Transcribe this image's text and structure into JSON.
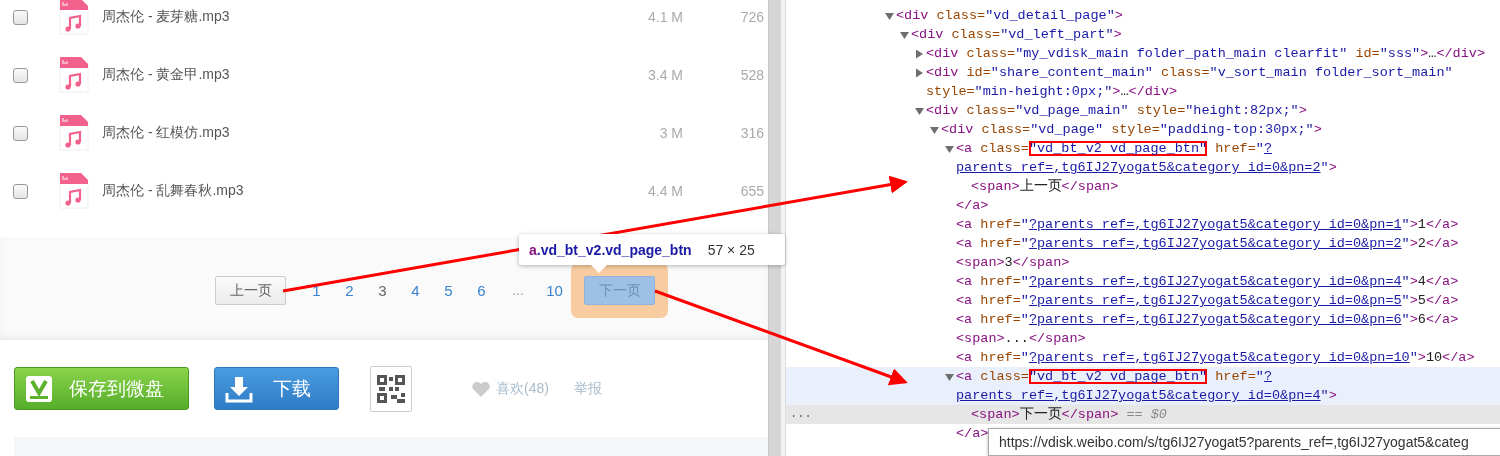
{
  "file_list": [
    {
      "name": "周杰伦 - 麦芽糖.mp3",
      "size": "4.1 M",
      "count": "726",
      "checked": false
    },
    {
      "name": "周杰伦 - 黄金甲.mp3",
      "size": "3.4 M",
      "count": "528",
      "checked": false
    },
    {
      "name": "周杰伦 - 红模仿.mp3",
      "size": "3 M",
      "count": "316",
      "checked": false
    },
    {
      "name": "周杰伦 - 乱舞春秋.mp3",
      "size": "4.4 M",
      "count": "655",
      "checked": false
    }
  ],
  "pagination": {
    "prev": {
      "label": "上一页",
      "inspected": false
    },
    "pages": [
      {
        "kind": "page",
        "label": "1",
        "selected": false
      },
      {
        "kind": "page",
        "label": "2",
        "selected": false
      },
      {
        "kind": "page",
        "label": "3",
        "selected": true
      },
      {
        "kind": "page",
        "label": "4",
        "selected": false
      },
      {
        "kind": "page",
        "label": "5",
        "selected": false
      },
      {
        "kind": "page",
        "label": "6",
        "selected": false
      },
      {
        "kind": "gap",
        "label": "...",
        "selected": false
      },
      {
        "kind": "page",
        "label": "10",
        "selected": false
      }
    ],
    "next": {
      "label": "下一页",
      "inspected": true
    }
  },
  "inspect_tooltip": {
    "tag": "a",
    "classes": ".vd_bt_v2.vd_page_btn",
    "size": "57 × 25"
  },
  "actions": {
    "save": "保存到微盘",
    "download": "下载",
    "like": "喜欢(48)",
    "report": "举报"
  },
  "dom_tree": [
    {
      "kind": "branch",
      "expanded": true,
      "selected": false,
      "open": [
        {
          "kind": "tag",
          "text": "<div"
        },
        {
          "kind": "attr",
          "text": " class="
        },
        {
          "kind": "val",
          "text": "\"vd_detail_page\""
        },
        {
          "kind": "tag",
          "text": ">"
        }
      ],
      "children": [
        {
          "kind": "branch",
          "expanded": true,
          "selected": false,
          "open": [
            {
              "kind": "tag",
              "text": "<div"
            },
            {
              "kind": "attr",
              "text": " class="
            },
            {
              "kind": "val",
              "text": "\"vd_left_part\""
            },
            {
              "kind": "tag",
              "text": ">"
            }
          ],
          "children": [
            {
              "kind": "branch",
              "expanded": false,
              "selected": false,
              "open": [
                {
                  "kind": "tag",
                  "text": "<div"
                },
                {
                  "kind": "attr",
                  "text": " class="
                },
                {
                  "kind": "val",
                  "text": "\"my_vdisk_main folder_path_main clearfit\""
                },
                {
                  "kind": "attr",
                  "text": " id="
                },
                {
                  "kind": "val",
                  "text": "\"sss\""
                },
                {
                  "kind": "tag",
                  "text": ">"
                },
                {
                  "kind": "text",
                  "text": "…"
                },
                {
                  "kind": "tag",
                  "text": "</div>"
                }
              ]
            },
            {
              "kind": "branch",
              "expanded": false,
              "selected": false,
              "open": [
                {
                  "kind": "tag",
                  "text": "<div"
                },
                {
                  "kind": "attr",
                  "text": " id="
                },
                {
                  "kind": "val",
                  "text": "\"share_content_main\""
                },
                {
                  "kind": "attr",
                  "text": " class="
                },
                {
                  "kind": "val",
                  "text": "\"v_sort_main folder_sort_main\""
                },
                {
                  "kind": "attr",
                  "text": " style="
                },
                {
                  "kind": "val",
                  "text": "\"min-height:0px;\""
                },
                {
                  "kind": "tag",
                  "text": ">"
                },
                {
                  "kind": "text",
                  "text": "…"
                },
                {
                  "kind": "tag",
                  "text": "</div>"
                }
              ]
            },
            {
              "kind": "branch",
              "expanded": true,
              "selected": false,
              "open": [
                {
                  "kind": "tag",
                  "text": "<div"
                },
                {
                  "kind": "attr",
                  "text": " class="
                },
                {
                  "kind": "val",
                  "text": "\"vd_page_main\""
                },
                {
                  "kind": "attr",
                  "text": " style="
                },
                {
                  "kind": "val",
                  "text": "\"height:82px;\""
                },
                {
                  "kind": "tag",
                  "text": ">"
                }
              ],
              "children": [
                {
                  "kind": "branch",
                  "expanded": true,
                  "selected": false,
                  "open": [
                    {
                      "kind": "tag",
                      "text": "<div"
                    },
                    {
                      "kind": "attr",
                      "text": " class="
                    },
                    {
                      "kind": "val",
                      "text": "\"vd_page\""
                    },
                    {
                      "kind": "attr",
                      "text": " style="
                    },
                    {
                      "kind": "val",
                      "text": "\"padding-top:30px;\""
                    },
                    {
                      "kind": "tag",
                      "text": ">"
                    }
                  ],
                  "children": [
                    {
                      "kind": "branch",
                      "expanded": true,
                      "selected": false,
                      "open": [
                        {
                          "kind": "tag",
                          "text": "<a"
                        },
                        {
                          "kind": "attr",
                          "text": " class="
                        },
                        {
                          "kind": "valbox",
                          "text": "\"vd_bt_v2 vd_page_btn\""
                        },
                        {
                          "kind": "attr",
                          "text": " href="
                        },
                        {
                          "kind": "val",
                          "text": "\""
                        },
                        {
                          "kind": "link",
                          "text": "?parents_ref=,tg6IJ27yogat5&category_id=0&pn=2"
                        },
                        {
                          "kind": "val",
                          "text": "\""
                        },
                        {
                          "kind": "tag",
                          "text": ">"
                        }
                      ],
                      "children": [
                        {
                          "kind": "leaf",
                          "selected": false,
                          "open": [
                            {
                              "kind": "tag",
                              "text": "<span>"
                            },
                            {
                              "kind": "text",
                              "text": "上一页"
                            },
                            {
                              "kind": "tag",
                              "text": "</span>"
                            }
                          ]
                        }
                      ],
                      "close": [
                        {
                          "kind": "tag",
                          "text": "</a>"
                        }
                      ]
                    },
                    {
                      "kind": "leaf",
                      "selected": false,
                      "open": [
                        {
                          "kind": "tag",
                          "text": "<a"
                        },
                        {
                          "kind": "attr",
                          "text": " href="
                        },
                        {
                          "kind": "val",
                          "text": "\""
                        },
                        {
                          "kind": "link",
                          "text": "?parents_ref=,tg6IJ27yogat5&category_id=0&pn=1"
                        },
                        {
                          "kind": "val",
                          "text": "\""
                        },
                        {
                          "kind": "tag",
                          "text": ">"
                        },
                        {
                          "kind": "text",
                          "text": "1"
                        },
                        {
                          "kind": "tag",
                          "text": "</a>"
                        }
                      ]
                    },
                    {
                      "kind": "leaf",
                      "selected": false,
                      "open": [
                        {
                          "kind": "tag",
                          "text": "<a"
                        },
                        {
                          "kind": "attr",
                          "text": " href="
                        },
                        {
                          "kind": "val",
                          "text": "\""
                        },
                        {
                          "kind": "link",
                          "text": "?parents_ref=,tg6IJ27yogat5&category_id=0&pn=2"
                        },
                        {
                          "kind": "val",
                          "text": "\""
                        },
                        {
                          "kind": "tag",
                          "text": ">"
                        },
                        {
                          "kind": "text",
                          "text": "2"
                        },
                        {
                          "kind": "tag",
                          "text": "</a>"
                        }
                      ]
                    },
                    {
                      "kind": "leaf",
                      "selected": false,
                      "open": [
                        {
                          "kind": "tag",
                          "text": "<span>"
                        },
                        {
                          "kind": "text",
                          "text": "3"
                        },
                        {
                          "kind": "tag",
                          "text": "</span>"
                        }
                      ]
                    },
                    {
                      "kind": "leaf",
                      "selected": false,
                      "open": [
                        {
                          "kind": "tag",
                          "text": "<a"
                        },
                        {
                          "kind": "attr",
                          "text": " href="
                        },
                        {
                          "kind": "val",
                          "text": "\""
                        },
                        {
                          "kind": "link",
                          "text": "?parents_ref=,tg6IJ27yogat5&category_id=0&pn=4"
                        },
                        {
                          "kind": "val",
                          "text": "\""
                        },
                        {
                          "kind": "tag",
                          "text": ">"
                        },
                        {
                          "kind": "text",
                          "text": "4"
                        },
                        {
                          "kind": "tag",
                          "text": "</a>"
                        }
                      ]
                    },
                    {
                      "kind": "leaf",
                      "selected": false,
                      "open": [
                        {
                          "kind": "tag",
                          "text": "<a"
                        },
                        {
                          "kind": "attr",
                          "text": " href="
                        },
                        {
                          "kind": "val",
                          "text": "\""
                        },
                        {
                          "kind": "link",
                          "text": "?parents_ref=,tg6IJ27yogat5&category_id=0&pn=5"
                        },
                        {
                          "kind": "val",
                          "text": "\""
                        },
                        {
                          "kind": "tag",
                          "text": ">"
                        },
                        {
                          "kind": "text",
                          "text": "5"
                        },
                        {
                          "kind": "tag",
                          "text": "</a>"
                        }
                      ]
                    },
                    {
                      "kind": "leaf",
                      "selected": false,
                      "open": [
                        {
                          "kind": "tag",
                          "text": "<a"
                        },
                        {
                          "kind": "attr",
                          "text": " href="
                        },
                        {
                          "kind": "val",
                          "text": "\""
                        },
                        {
                          "kind": "link",
                          "text": "?parents_ref=,tg6IJ27yogat5&category_id=0&pn=6"
                        },
                        {
                          "kind": "val",
                          "text": "\""
                        },
                        {
                          "kind": "tag",
                          "text": ">"
                        },
                        {
                          "kind": "text",
                          "text": "6"
                        },
                        {
                          "kind": "tag",
                          "text": "</a>"
                        }
                      ]
                    },
                    {
                      "kind": "leaf",
                      "selected": false,
                      "open": [
                        {
                          "kind": "tag",
                          "text": "<span>"
                        },
                        {
                          "kind": "text",
                          "text": "..."
                        },
                        {
                          "kind": "tag",
                          "text": "</span>"
                        }
                      ]
                    },
                    {
                      "kind": "leaf",
                      "selected": false,
                      "open": [
                        {
                          "kind": "tag",
                          "text": "<a"
                        },
                        {
                          "kind": "attr",
                          "text": " href="
                        },
                        {
                          "kind": "val",
                          "text": "\""
                        },
                        {
                          "kind": "link",
                          "text": "?parents_ref=,tg6IJ27yogat5&category_id=0&pn=10"
                        },
                        {
                          "kind": "val",
                          "text": "\""
                        },
                        {
                          "kind": "tag",
                          "text": ">"
                        },
                        {
                          "kind": "text",
                          "text": "10"
                        },
                        {
                          "kind": "tag",
                          "text": "</a>"
                        }
                      ]
                    },
                    {
                      "kind": "branch",
                      "expanded": true,
                      "selected": true,
                      "open": [
                        {
                          "kind": "tag",
                          "text": "<a"
                        },
                        {
                          "kind": "attr",
                          "text": " class="
                        },
                        {
                          "kind": "valbox",
                          "text": "\"vd_bt_v2 vd_page_btn\""
                        },
                        {
                          "kind": "attr",
                          "text": " href="
                        },
                        {
                          "kind": "val",
                          "text": "\""
                        },
                        {
                          "kind": "link",
                          "text": "?parents_ref=,tg6IJ27yogat5&category_id=0&pn=4"
                        },
                        {
                          "kind": "val",
                          "text": "\""
                        },
                        {
                          "kind": "tag",
                          "text": ">"
                        }
                      ],
                      "children": [
                        {
                          "kind": "leaf",
                          "selected": false,
                          "gutter": "...",
                          "open": [
                            {
                              "kind": "tag",
                              "text": "<span>"
                            },
                            {
                              "kind": "text",
                              "text": "下一页"
                            },
                            {
                              "kind": "tag",
                              "text": "</span>"
                            },
                            {
                              "kind": "dim",
                              "text": " == $0"
                            }
                          ]
                        }
                      ],
                      "close": [
                        {
                          "kind": "tag",
                          "text": "</a>"
                        }
                      ]
                    }
                  ]
                }
              ]
            }
          ]
        }
      ]
    }
  ],
  "link_tooltip": "https://vdisk.weibo.com/s/tg6IJ27yogat5?parents_ref=,tg6IJ27yogat5&categ"
}
